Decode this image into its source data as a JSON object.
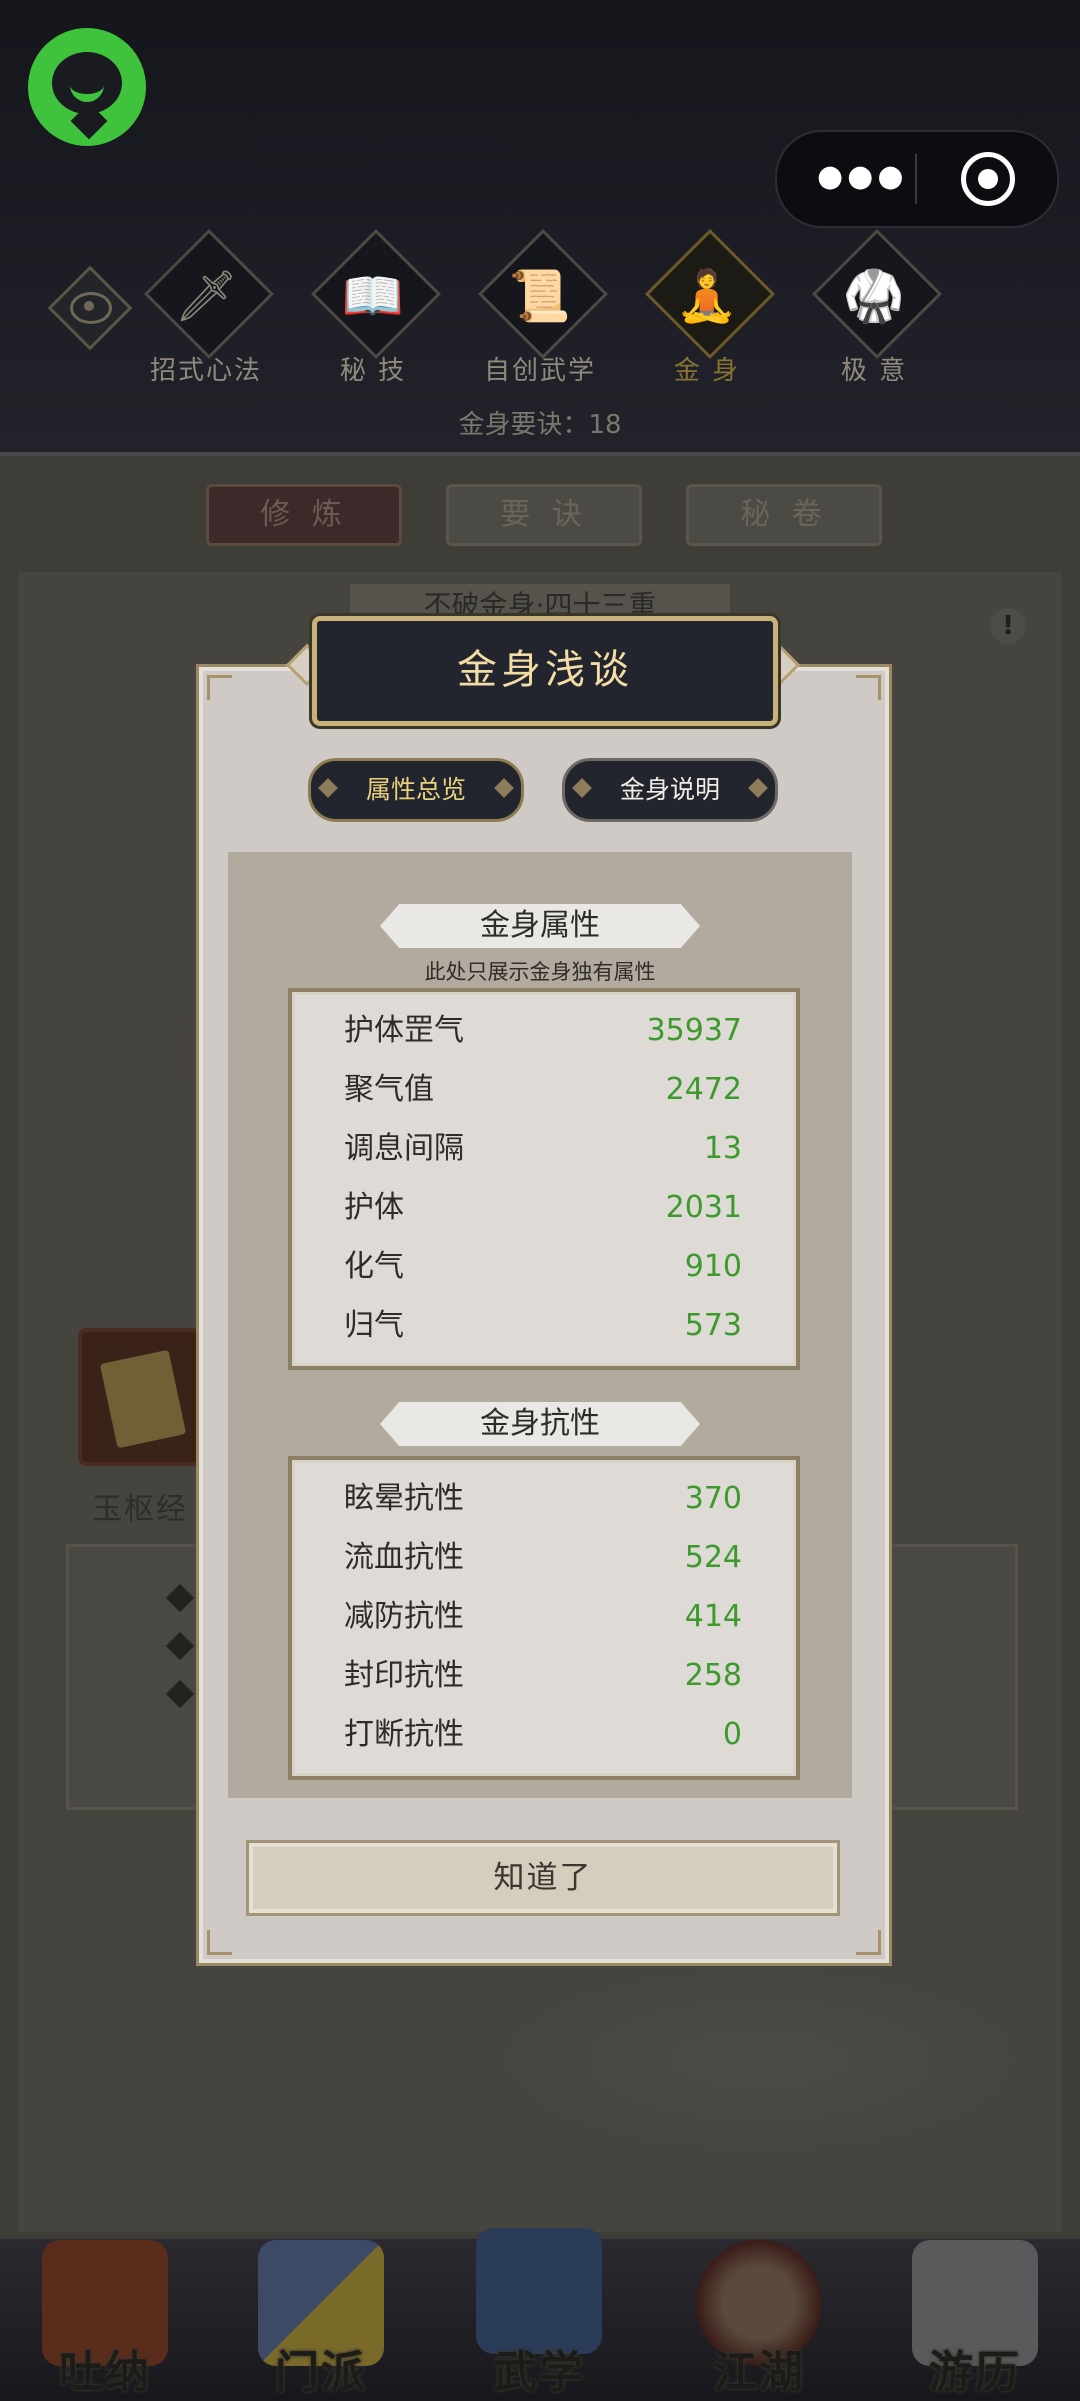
{
  "header": {
    "tabs": [
      {
        "label": "招式心法",
        "icon": "sword-icon",
        "glyph": "🗡"
      },
      {
        "label": "秘 技",
        "icon": "book-icon",
        "glyph": "📖"
      },
      {
        "label": "自创武学",
        "icon": "scroll-icon",
        "glyph": "📜"
      },
      {
        "label": "金 身",
        "icon": "meditation-icon",
        "glyph": "🧘",
        "active": true
      },
      {
        "label": "极 意",
        "icon": "martial-pose-icon",
        "glyph": "🥋"
      }
    ],
    "info": "金身要诀：18"
  },
  "page": {
    "pills": [
      "修 炼",
      "要 诀",
      "秘 卷"
    ],
    "banner": "不破金身·四十三重",
    "book_name": "玉枢经"
  },
  "modal": {
    "title": "金身浅谈",
    "tabs": [
      {
        "label": "属性总览",
        "active": true
      },
      {
        "label": "金身说明",
        "active": false
      }
    ],
    "section1": {
      "title": "金身属性",
      "subtitle": "此处只展示金身独有属性",
      "rows": [
        {
          "label": "护体罡气",
          "value": "35937"
        },
        {
          "label": "聚气值",
          "value": "2472"
        },
        {
          "label": "调息间隔",
          "value": "13"
        },
        {
          "label": "护体",
          "value": "2031"
        },
        {
          "label": "化气",
          "value": "910"
        },
        {
          "label": "归气",
          "value": "573"
        }
      ]
    },
    "section2": {
      "title": "金身抗性",
      "rows": [
        {
          "label": "眩晕抗性",
          "value": "370"
        },
        {
          "label": "流血抗性",
          "value": "524"
        },
        {
          "label": "减防抗性",
          "value": "414"
        },
        {
          "label": "封印抗性",
          "value": "258"
        },
        {
          "label": "打断抗性",
          "value": "0"
        }
      ]
    },
    "ok_label": "知道了"
  },
  "bottom_nav": [
    {
      "label": "吐纳",
      "icon": "meditate-figure-icon"
    },
    {
      "label": "门派",
      "icon": "sect-flag-icon"
    },
    {
      "label": "武学",
      "icon": "martial-book-icon"
    },
    {
      "label": "江湖",
      "icon": "bamboo-hat-icon"
    },
    {
      "label": "游历",
      "icon": "white-horse-icon"
    }
  ],
  "colors": {
    "value_green": "#3e9a2d",
    "title_gold": "#f1dca4",
    "brand_green": "#3fc23c"
  }
}
